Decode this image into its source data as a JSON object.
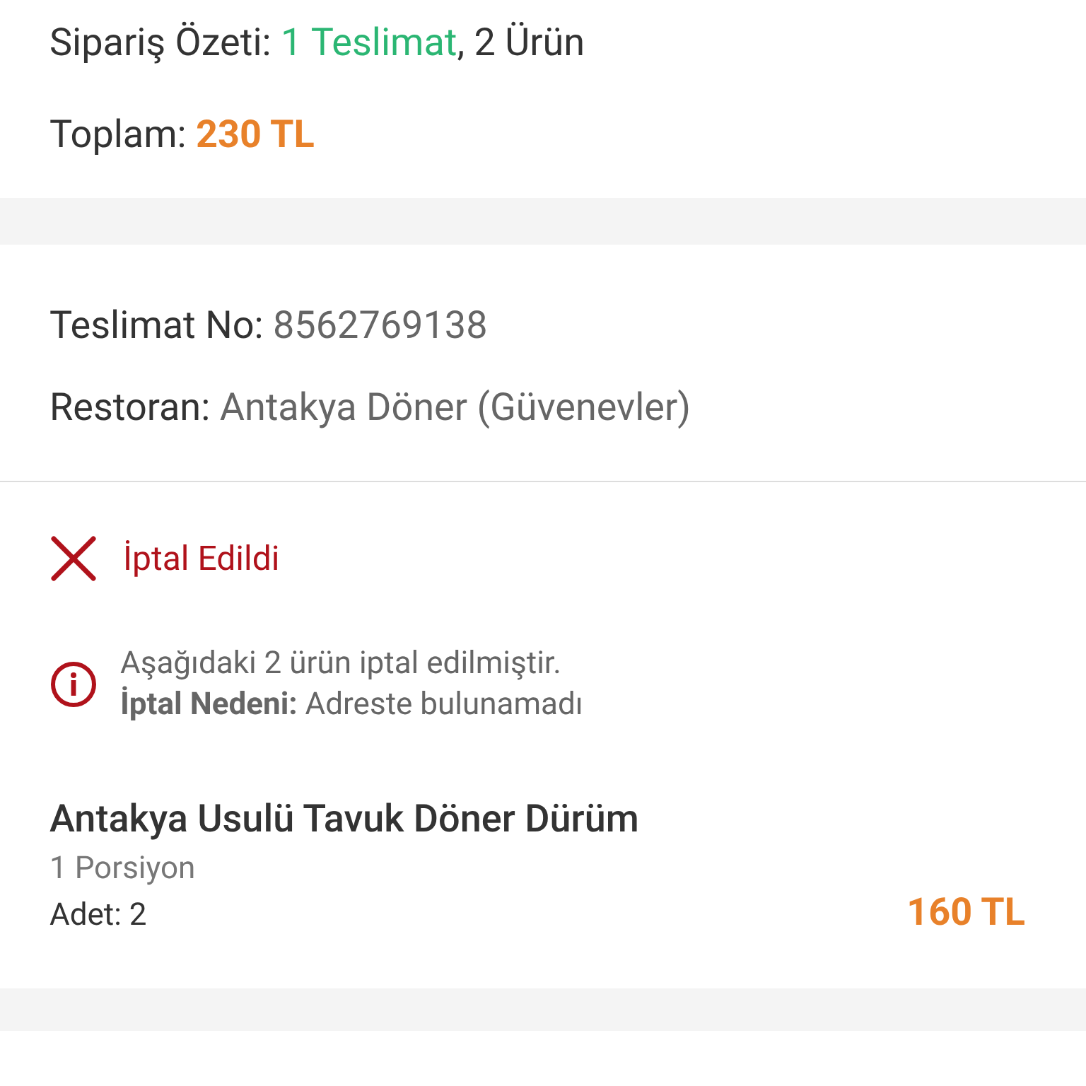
{
  "summary": {
    "label": "Sipariş Özeti:",
    "deliveries": "1 Teslimat",
    "items": ", 2 Ürün",
    "total_label": "Toplam:",
    "total": "230 TL"
  },
  "delivery": {
    "number_label": "Teslimat No:",
    "number": "8562769138",
    "restaurant_label": "Restoran:",
    "restaurant": "Antakya Döner (Güvenevler)"
  },
  "status": {
    "kind": "cancelled",
    "text": "İptal Edildi"
  },
  "notice": {
    "line_1": "Aşağıdaki 2 ürün iptal edilmiştir.",
    "line_2": "**İptal Nedeni:** Adreste bulunamadı"
  },
  "products": [
    {
      "name": "Antakya Usulü Tavuk Döner Dürüm",
      "portion": "1 Porsiyon",
      "quantity": "Adet: 2",
      "price": "160 TL"
    }
  ]
}
